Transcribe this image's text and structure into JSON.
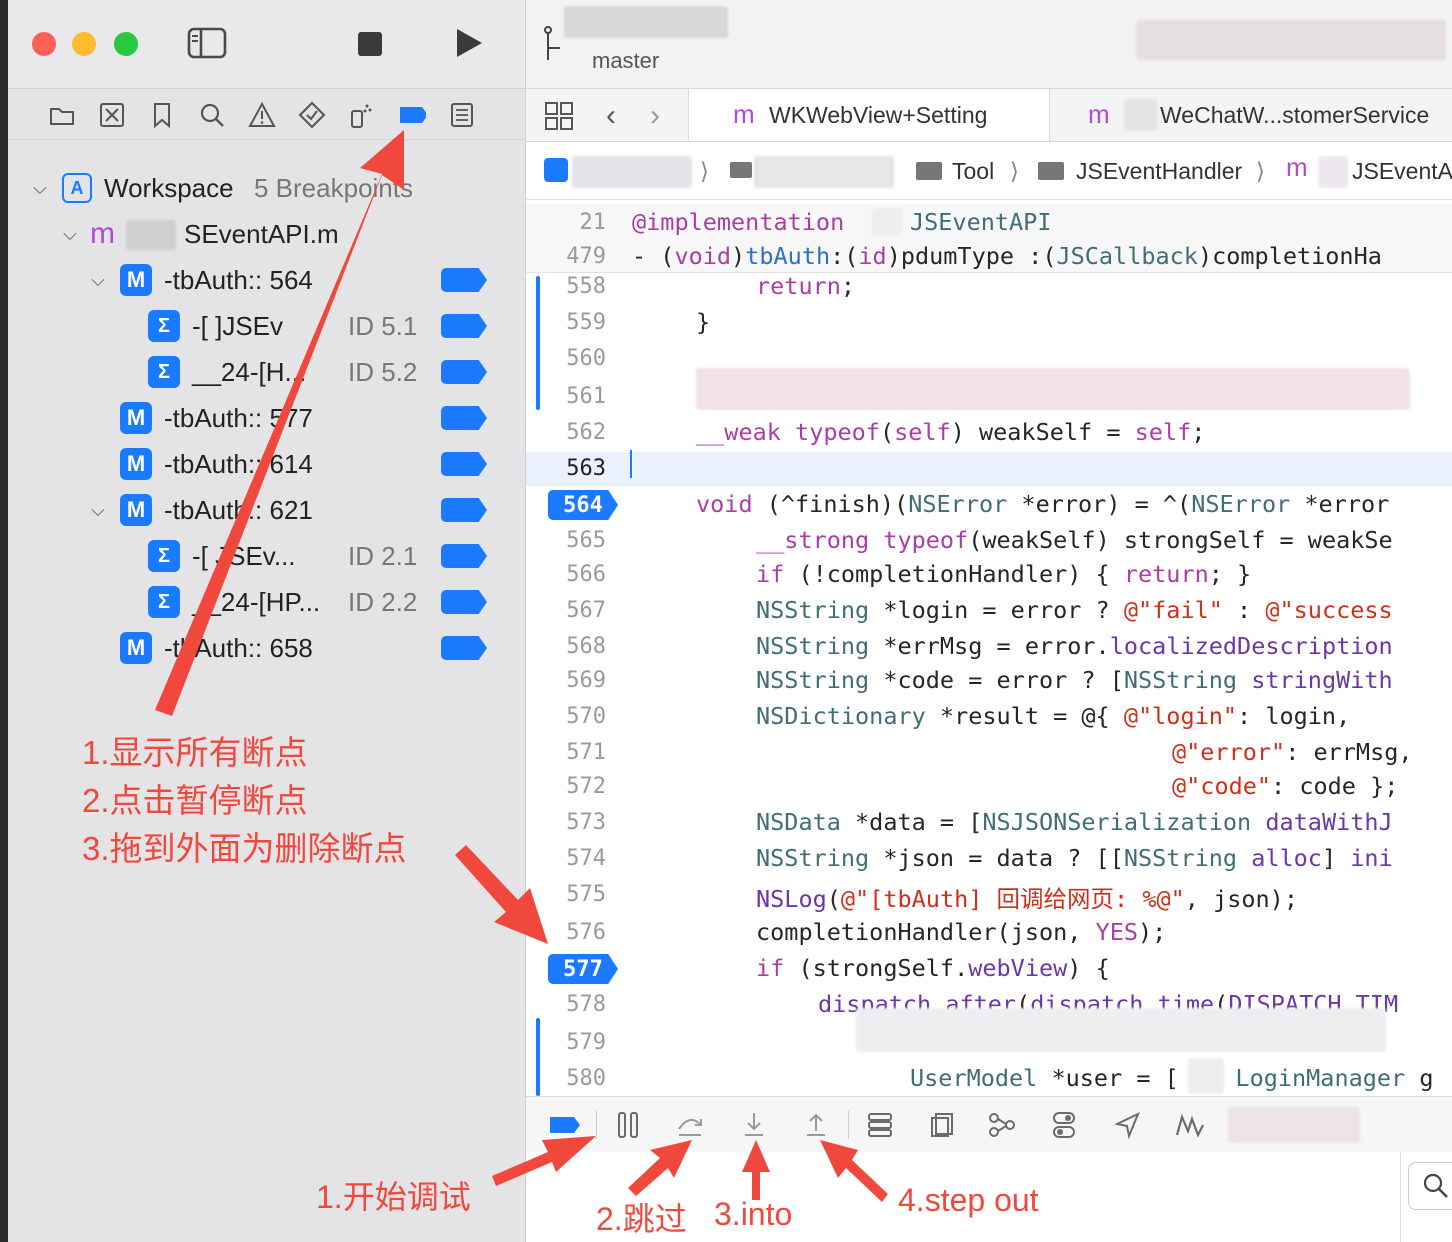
{
  "toolbar": {
    "branch": "master",
    "tabs": [
      {
        "prefix": "m",
        "label": "WKWebView+Setting"
      },
      {
        "prefix": "m",
        "label": "WeChatW...stomerService"
      }
    ]
  },
  "jumpbar": {
    "sep": "⟩",
    "crumbs": [
      "Tool",
      "JSEventHandler"
    ],
    "file_prefix": "m",
    "file": "JSEventA"
  },
  "navigator": {
    "workspace_label": "Workspace",
    "workspace_count": "5 Breakpoints",
    "file_prefix": "m",
    "file_name": "SEventAPI.m",
    "items": [
      {
        "badge": "M",
        "label": "-tbAuth:: 564"
      },
      {
        "badge": "Σ",
        "label": "-[   ]JSEv",
        "id": "ID 5.1"
      },
      {
        "badge": "Σ",
        "label": "__24-[H...",
        "id": "ID 5.2"
      },
      {
        "badge": "M",
        "label": "-tbAuth:: 577"
      },
      {
        "badge": "M",
        "label": "-tbAuth:: 614"
      },
      {
        "badge": "M",
        "label": "-tbAuth:: 621"
      },
      {
        "badge": "Σ",
        "label": "-[   JSEv...",
        "id": "ID 2.1"
      },
      {
        "badge": "Σ",
        "label": "__24-[HP...",
        "id": "ID 2.2"
      },
      {
        "badge": "M",
        "label": "-tbAuth:: 658"
      }
    ]
  },
  "annotations": {
    "left_1": "1.显示所有断点",
    "left_2": "2.点击暂停断点",
    "left_3": "3.拖到外面为删除断点",
    "debug_1": "1.开始调试",
    "debug_2": "2.跳过",
    "debug_3": "3.into",
    "debug_4": "4.step out"
  },
  "code": {
    "header_ln": "21",
    "header_kw": "@implementation",
    "header_class": "JSEventAPI",
    "sig_ln": "479",
    "lines": [
      {
        "n": "558",
        "t": "return;"
      },
      {
        "n": "559",
        "t": "}"
      },
      {
        "n": "560",
        "t": ""
      },
      {
        "n": "561",
        "t": ""
      },
      {
        "n": "562",
        "t": "__weak typeof(self) weakSelf = self;"
      },
      {
        "n": "563",
        "t": ""
      },
      {
        "n": "564",
        "t": "void (^finish)(NSError *error) = ^(NSError *error"
      },
      {
        "n": "565",
        "t": "__strong typeof(weakSelf) strongSelf = weakSe"
      },
      {
        "n": "566",
        "t": "if (!completionHandler) { return; }"
      },
      {
        "n": "567",
        "t": "NSString *login = error ? @\"fail\" : @\"success"
      },
      {
        "n": "568",
        "t": "NSString *errMsg = error.localizedDescription"
      },
      {
        "n": "569",
        "t": "NSString *code = error ? [NSString stringWith"
      },
      {
        "n": "570",
        "t": "NSDictionary *result = @{ @\"login\": login,"
      },
      {
        "n": "571",
        "t": "@\"error\": errMsg,"
      },
      {
        "n": "572",
        "t": "@\"code\": code };"
      },
      {
        "n": "573",
        "t": "NSData *data = [NSJSONSerialization dataWithJ"
      },
      {
        "n": "574",
        "t": "NSString *json = data ? [[NSString alloc] ini"
      },
      {
        "n": "575",
        "t": "NSLog(@\"[tbAuth] 回调给网页: %@\", json);"
      },
      {
        "n": "576",
        "t": "completionHandler(json, YES);"
      },
      {
        "n": "577",
        "t": "if (strongSelf.webView) {"
      },
      {
        "n": "578",
        "t": "dispatch_after(dispatch_time(DISPATCH_TIM"
      },
      {
        "n": "579",
        "t": ""
      },
      {
        "n": "580",
        "t": "UserModel *user = [    LoginManager g"
      }
    ]
  }
}
